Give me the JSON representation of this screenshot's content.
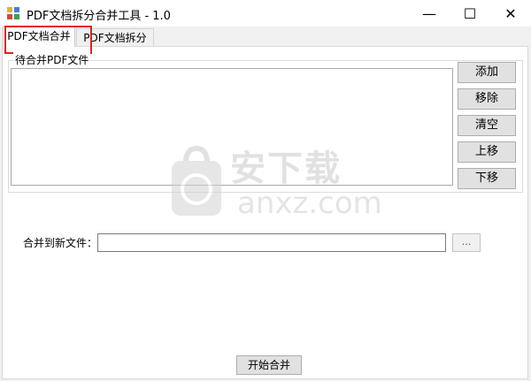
{
  "window": {
    "title": "PDF文档拆分合并工具 - 1.0",
    "controls": {
      "minimize": "—",
      "maximize": "☐",
      "close": "✕"
    }
  },
  "tabs": [
    {
      "label": "PDF文档合并",
      "selected": true
    },
    {
      "label": "PDF文档拆分",
      "selected": false
    }
  ],
  "merge": {
    "group_label": "待合并PDF文件",
    "buttons": {
      "add": "添加",
      "remove": "移除",
      "clear": "清空",
      "move_up": "上移",
      "move_down": "下移"
    },
    "output_label": "合并到新文件：",
    "output_value": "",
    "browse_label": "...",
    "start_label": "开始合并"
  },
  "watermark": {
    "cn": "安下载",
    "en": "anxz.com"
  },
  "colors": {
    "highlight": "#e02020",
    "button_face": "#e1e1e1"
  }
}
